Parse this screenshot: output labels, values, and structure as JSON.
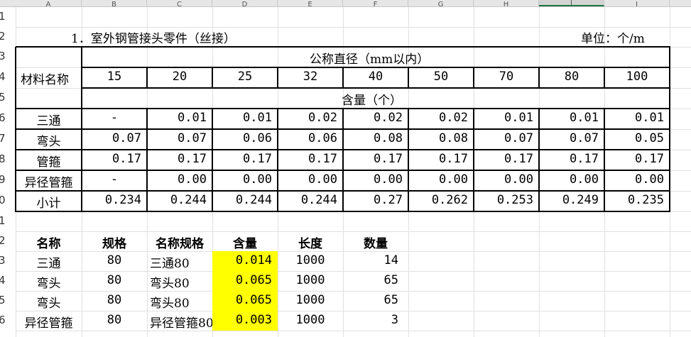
{
  "column_headers": [
    "A",
    "B",
    "C",
    "D",
    "E",
    "F",
    "G",
    "H",
    "I",
    "J"
  ],
  "row_headers": [
    "1",
    "2",
    "3",
    "4",
    "5",
    "6",
    "7",
    "8",
    "9",
    "0",
    "1",
    "2",
    "3",
    "4",
    "5",
    "6"
  ],
  "title": "1．室外钢管接头零件（丝接）",
  "unit": "单位：个/m",
  "table1": {
    "material_header": "材料名称",
    "diameter_header": "公称直径（mm以内）",
    "content_header": "含量（个）",
    "diameters": [
      "15",
      "20",
      "25",
      "32",
      "40",
      "50",
      "70",
      "80",
      "100"
    ],
    "rows": [
      {
        "name": "三通",
        "values": [
          "-",
          "0.01",
          "0.01",
          "0.02",
          "0.02",
          "0.02",
          "0.01",
          "0.01",
          "0.01"
        ]
      },
      {
        "name": "弯头",
        "values": [
          "0.07",
          "0.07",
          "0.06",
          "0.06",
          "0.08",
          "0.08",
          "0.07",
          "0.07",
          "0.05"
        ]
      },
      {
        "name": "管箍",
        "values": [
          "0.17",
          "0.17",
          "0.17",
          "0.17",
          "0.17",
          "0.17",
          "0.17",
          "0.17",
          "0.17"
        ]
      },
      {
        "name": "异径管箍",
        "values": [
          "-",
          "0.00",
          "0.00",
          "0.00",
          "0.00",
          "0.00",
          "0.00",
          "0.00",
          "0.00"
        ]
      },
      {
        "name": "小计",
        "values": [
          "0.234",
          "0.244",
          "0.244",
          "0.244",
          "0.27",
          "0.262",
          "0.253",
          "0.249",
          "0.235"
        ]
      }
    ]
  },
  "table2": {
    "headers": [
      "名称",
      "规格",
      "名称规格",
      "含量",
      "长度",
      "数量"
    ],
    "rows": [
      {
        "name": "三通",
        "spec": "80",
        "name_spec": "三通80",
        "content": "0.014",
        "length": "1000",
        "qty": "14"
      },
      {
        "name": "弯头",
        "spec": "80",
        "name_spec": "弯头80",
        "content": "0.065",
        "length": "1000",
        "qty": "65"
      },
      {
        "name": "弯头",
        "spec": "80",
        "name_spec": "弯头80",
        "content": "0.065",
        "length": "1000",
        "qty": "65"
      },
      {
        "name": "异径管箍",
        "spec": "80",
        "name_spec": "异径管箍80",
        "content": "0.003",
        "length": "1000",
        "qty": "3"
      }
    ]
  },
  "colors": {
    "highlight": "#ffff00",
    "grid": "#e0e0e0",
    "header_bg": "#e6e6e6",
    "selection": "#217346"
  }
}
